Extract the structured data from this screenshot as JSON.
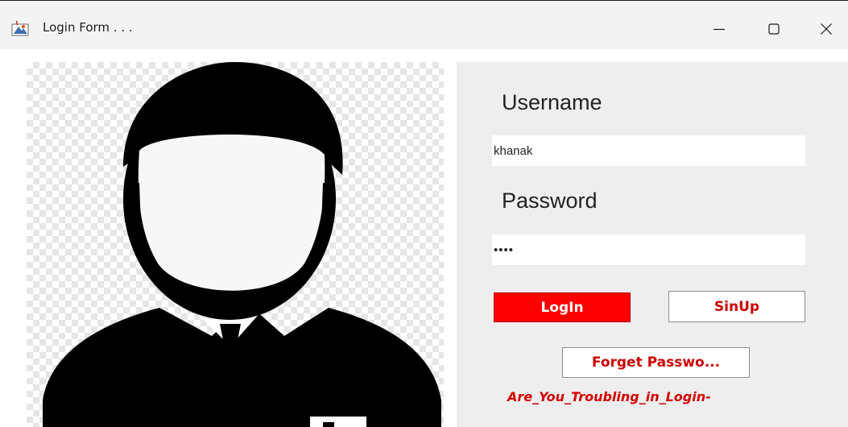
{
  "window": {
    "title": "Login Form . . .",
    "controls": {
      "minimize": "minimize-icon",
      "maximize": "maximize-icon",
      "close": "close-icon"
    }
  },
  "form": {
    "username_label": "Username",
    "username_value": "khanak",
    "password_label": "Password",
    "password_value": "••••",
    "login_button": "LogIn",
    "signup_button": "SinUp",
    "forget_button": "Forget Passwo...",
    "trouble_link": "Are_You_Troubling_in_Login-"
  },
  "colors": {
    "panel_bg": "#eeeeee",
    "login_button_bg": "#ff0000",
    "accent_text": "#cc0000"
  },
  "icons": {
    "app": "java-app-icon",
    "avatar": "user-avatar-image"
  }
}
